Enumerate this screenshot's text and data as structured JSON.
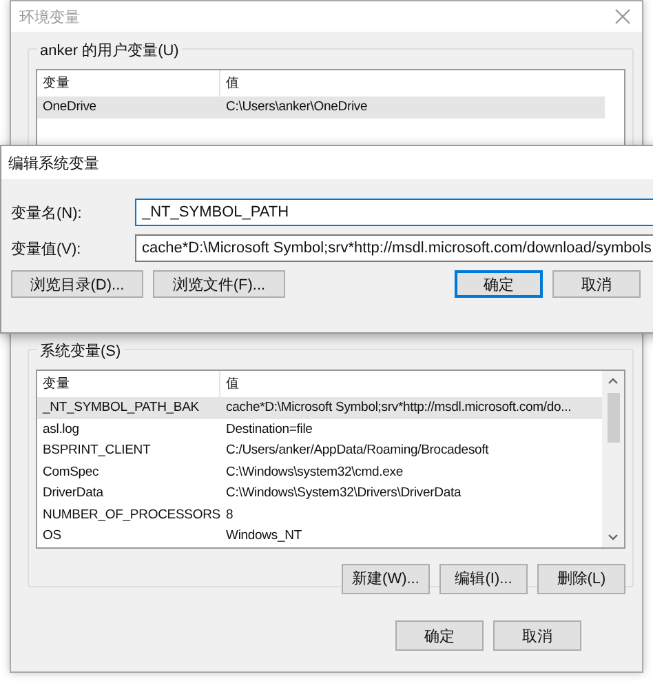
{
  "window": {
    "title": "环境变量"
  },
  "user_variables": {
    "label": "anker 的用户变量(U)",
    "columns": [
      "变量",
      "值"
    ],
    "rows": [
      {
        "name": "OneDrive",
        "value": "C:\\Users\\anker\\OneDrive",
        "selected": true
      }
    ]
  },
  "edit_dialog": {
    "title": "编辑系统变量",
    "fields": [
      {
        "label": "变量名(N):",
        "value": "_NT_SYMBOL_PATH"
      },
      {
        "label": "变量值(V):",
        "value": "cache*D:\\Microsoft Symbol;srv*http://msdl.microsoft.com/download/symbols"
      }
    ],
    "buttons": [
      {
        "label": "浏览目录(D)...",
        "default": false
      },
      {
        "label": "浏览文件(F)...",
        "default": false
      },
      {
        "label": "确定",
        "default": true
      },
      {
        "label": "取消",
        "default": false
      }
    ]
  },
  "system_variables": {
    "label": "系统变量(S)",
    "columns": [
      "变量",
      "值"
    ],
    "rows": [
      {
        "name": "_NT_SYMBOL_PATH_BAK",
        "value": "cache*D:\\Microsoft Symbol;srv*http://msdl.microsoft.com/do...",
        "selected": true
      },
      {
        "name": "asl.log",
        "value": "Destination=file",
        "selected": false
      },
      {
        "name": "BSPRINT_CLIENT",
        "value": "C:/Users/anker/AppData/Roaming/Brocadesoft",
        "selected": false
      },
      {
        "name": "ComSpec",
        "value": "C:\\Windows\\system32\\cmd.exe",
        "selected": false
      },
      {
        "name": "DriverData",
        "value": "C:\\Windows\\System32\\Drivers\\DriverData",
        "selected": false
      },
      {
        "name": "NUMBER_OF_PROCESSORS",
        "value": "8",
        "selected": false
      },
      {
        "name": "OS",
        "value": "Windows_NT",
        "selected": false
      }
    ],
    "buttons": [
      "新建(W)...",
      "编辑(I)...",
      "删除(L)"
    ]
  },
  "buttons": [
    "确定",
    "取消"
  ]
}
